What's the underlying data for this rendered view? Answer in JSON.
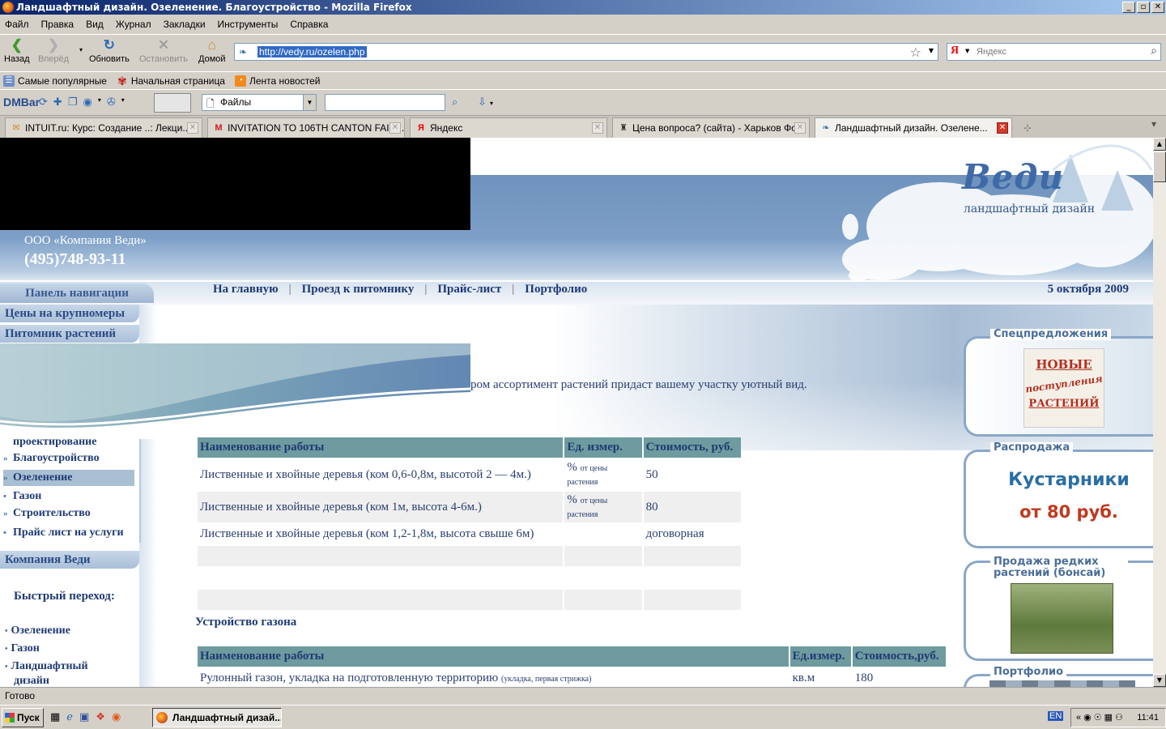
{
  "window": {
    "title": "Ландшафтный дизайн. Озеленение. Благоустройство - Mozilla Firefox",
    "btn_min": "_",
    "btn_max": "▫",
    "btn_close": "✕"
  },
  "menu": [
    "Файл",
    "Правка",
    "Вид",
    "Журнал",
    "Закладки",
    "Инструменты",
    "Справка"
  ],
  "nav": {
    "back": "Назад",
    "forward": "Вперёд",
    "reload": "Обновить",
    "stop": "Остановить",
    "home": "Домой",
    "url": "http://vedy.ru/ozelen.php",
    "search_placeholder": "Яндекс",
    "search_engine": "Я"
  },
  "bookmarks": [
    "Самые популярные",
    "Начальная страница",
    "Лента новостей"
  ],
  "dmbar": {
    "logo": "DMBar",
    "files_select": "Файлы"
  },
  "tabs": [
    {
      "label": "INTUIT.ru: Курс: Создание ..: Лекци..."
    },
    {
      "label": "INVITATION TO 106TH CANTON FAIR. ..."
    },
    {
      "label": "Яндекс"
    },
    {
      "label": "Цена вопроса? (сайта) - Харьков Фо..."
    },
    {
      "label": "Ландшафтный дизайн. Озелене..."
    }
  ],
  "site": {
    "logo_title": "Веди",
    "logo_subtitle": "ландшафтный дизайн",
    "company": "ООО «Компания Веди»",
    "phone": "(495)748-93-11",
    "panel_nav": "Панель навигации",
    "topnav": [
      "На главную",
      "Проезд к питомнику",
      "Прайс-лист",
      "Портфолио"
    ],
    "topnav_sep": "|",
    "date": "5 октября 2009",
    "side_top": [
      "Цены на крупномеры",
      "Питомник растений"
    ],
    "side_sub": [
      {
        "bullet": "",
        "label": "проектирование"
      },
      {
        "bullet": "»",
        "label": "Благоустройство"
      },
      {
        "bullet": "»",
        "label": "Озеленение"
      },
      {
        "bullet": "•",
        "label": "Газон"
      },
      {
        "bullet": "»",
        "label": "Строительство"
      },
      {
        "bullet": "•",
        "label": "Прайс лист на услуги"
      }
    ],
    "company_section": "Компания Веди",
    "quick_label": "Быстрый переход:",
    "quick": [
      "Озеленение",
      "Газон",
      "Ландшафтный",
      "дизайн"
    ],
    "quick_bullet": "•",
    "intro_text": "ром ассортимент растений придаст вашему участку уютный вид.",
    "table1": {
      "headers": [
        "Наименование работы",
        "Ед. измер.",
        "Стоимость, руб."
      ],
      "rows": [
        {
          "name": "Лиственные  и хвойные деревья (ком 0,6-0,8м, высотой 2 — 4м.)",
          "unit": "%",
          "unit_note": "от цены растения",
          "price": "50"
        },
        {
          "name": "Лиственные и хвойные деревья (ком 1м, высота 4-6м.)",
          "unit": "%",
          "unit_note": "от цены растения",
          "price": "80"
        },
        {
          "name": "Лиственные и хвойные деревья (ком 1,2-1,8м, высота свыше 6м)",
          "unit": "",
          "unit_note": "",
          "price": "договорная"
        }
      ]
    },
    "section2_title": "Устройство газона",
    "table2": {
      "headers": [
        "Наименование работы",
        "Ед.измер.",
        "Стоимость,руб."
      ],
      "row": {
        "name": "Рулонный газон, укладка на подготовленную территорию",
        "note": "(укладка, первая стрижка)",
        "unit": "кв.м",
        "price": "180"
      }
    },
    "right": {
      "special_title": "Спецпредложения",
      "new_line1": "НОВЫЕ",
      "new_line2": "поступления",
      "new_line3": "РАСТЕНИЙ",
      "sale_title": "Распродажа",
      "sale_line1": "Кустарники",
      "sale_line2": "от 80 руб.",
      "rare_title": "Продажа редких растений (бонсай)",
      "portfolio_title": "Портфолио"
    }
  },
  "status": "Готово",
  "taskbar": {
    "start": "Пуск",
    "task": "Ландшафтный дизай...",
    "lang": "EN",
    "clock": "11:41"
  }
}
